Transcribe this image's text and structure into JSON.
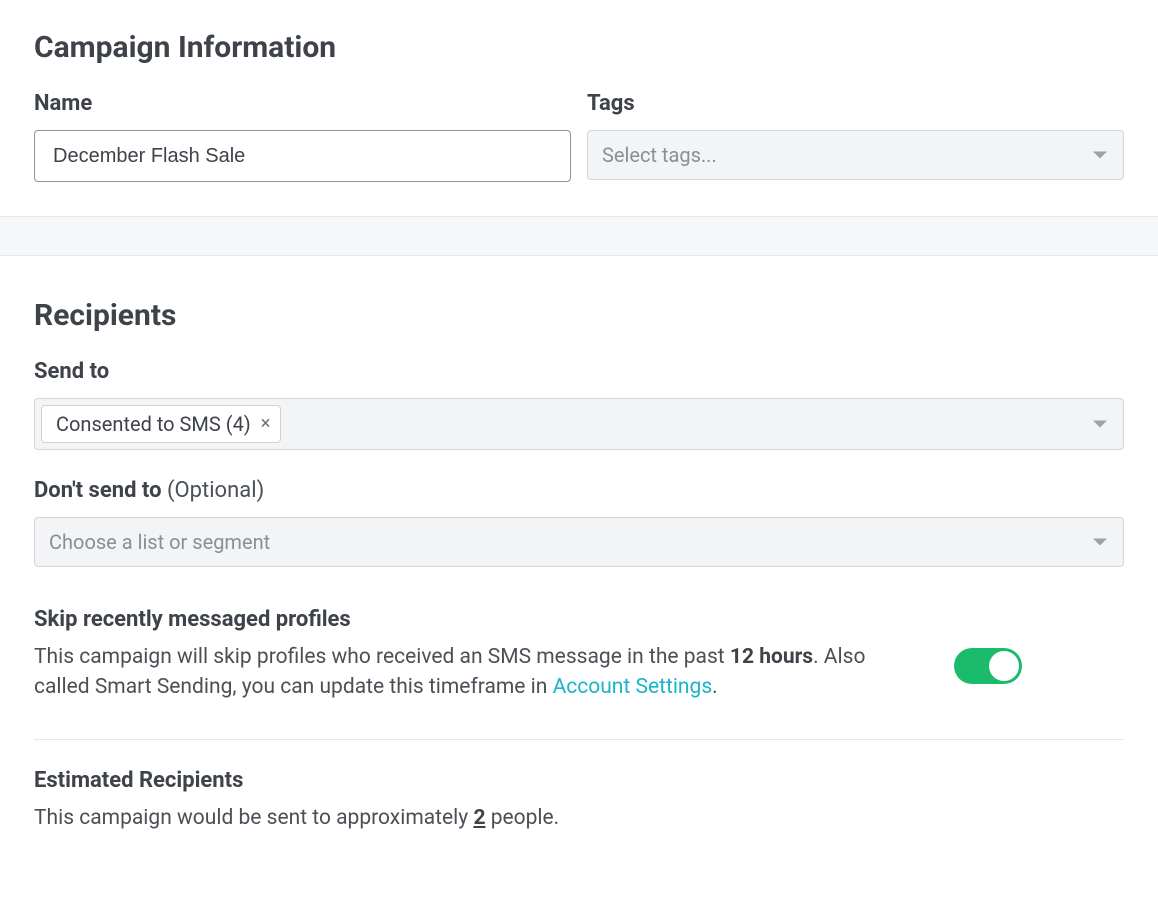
{
  "campaign_info": {
    "section_title": "Campaign Information",
    "name_label": "Name",
    "name_value": "December Flash Sale",
    "tags_label": "Tags",
    "tags_placeholder": "Select tags..."
  },
  "recipients": {
    "section_title": "Recipients",
    "send_to_label": "Send to",
    "send_to_chip": "Consented to SMS (4)",
    "dont_send_label": "Don't send to",
    "dont_send_optional": "(Optional)",
    "dont_send_placeholder": "Choose a list or segment",
    "skip_title": "Skip recently messaged profiles",
    "skip_text_before": "This campaign will skip profiles who received an SMS message in the past ",
    "skip_hours": "12 hours",
    "skip_text_mid": ". Also called Smart Sending, you can update this timeframe in ",
    "skip_link": "Account Settings",
    "skip_text_after": ".",
    "estimated_title": "Estimated Recipients",
    "estimated_before": "This campaign would be sent to approximately ",
    "estimated_count": "2",
    "estimated_after": " people."
  }
}
